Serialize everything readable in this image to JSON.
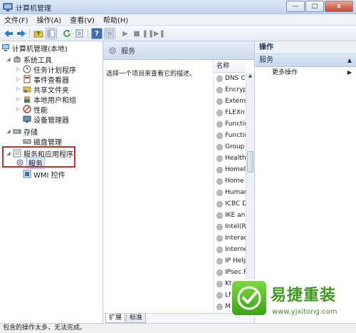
{
  "window": {
    "title": "计算机管理",
    "controls": [
      "—",
      "□",
      "x"
    ]
  },
  "menu": [
    "文件(F)",
    "操作(A)",
    "查看(V)",
    "帮助(H)"
  ],
  "tree": {
    "root": "计算机管理(本地)",
    "system_tools": "系统工具",
    "task_scheduler": "任务计划程序",
    "event_viewer": "事件查看器",
    "shared_folders": "共享文件夹",
    "local_users": "本地用户和组",
    "performance": "性能",
    "device_manager": "设备管理器",
    "storage": "存储",
    "disk_management": "磁盘管理",
    "services_apps": "服务和应用程序",
    "services": "服务",
    "wmi": "WMI 控件"
  },
  "center": {
    "header": "服务",
    "description": "选择一个项目来查看它的描述。",
    "column_name": "名称",
    "services": [
      "DNS C",
      "Encryp",
      "Extens",
      "FLEXn",
      "Functio",
      "Functio",
      "Group",
      "Health",
      "Homel",
      "Home",
      "Human",
      "ICBC D",
      "IKE an",
      "Intel(R",
      "Interac",
      "Interne",
      "IP Help",
      "IPsec F",
      "KtmRn",
      "LM",
      "Micr"
    ],
    "tabs": [
      "扩展",
      "标准"
    ]
  },
  "actions": {
    "title": "操作",
    "section": "服务",
    "more": "更多操作"
  },
  "status": "包含的操作太多，无法完成。",
  "watermark": {
    "title": "易捷重装",
    "url": "www.yjxitong.com"
  }
}
